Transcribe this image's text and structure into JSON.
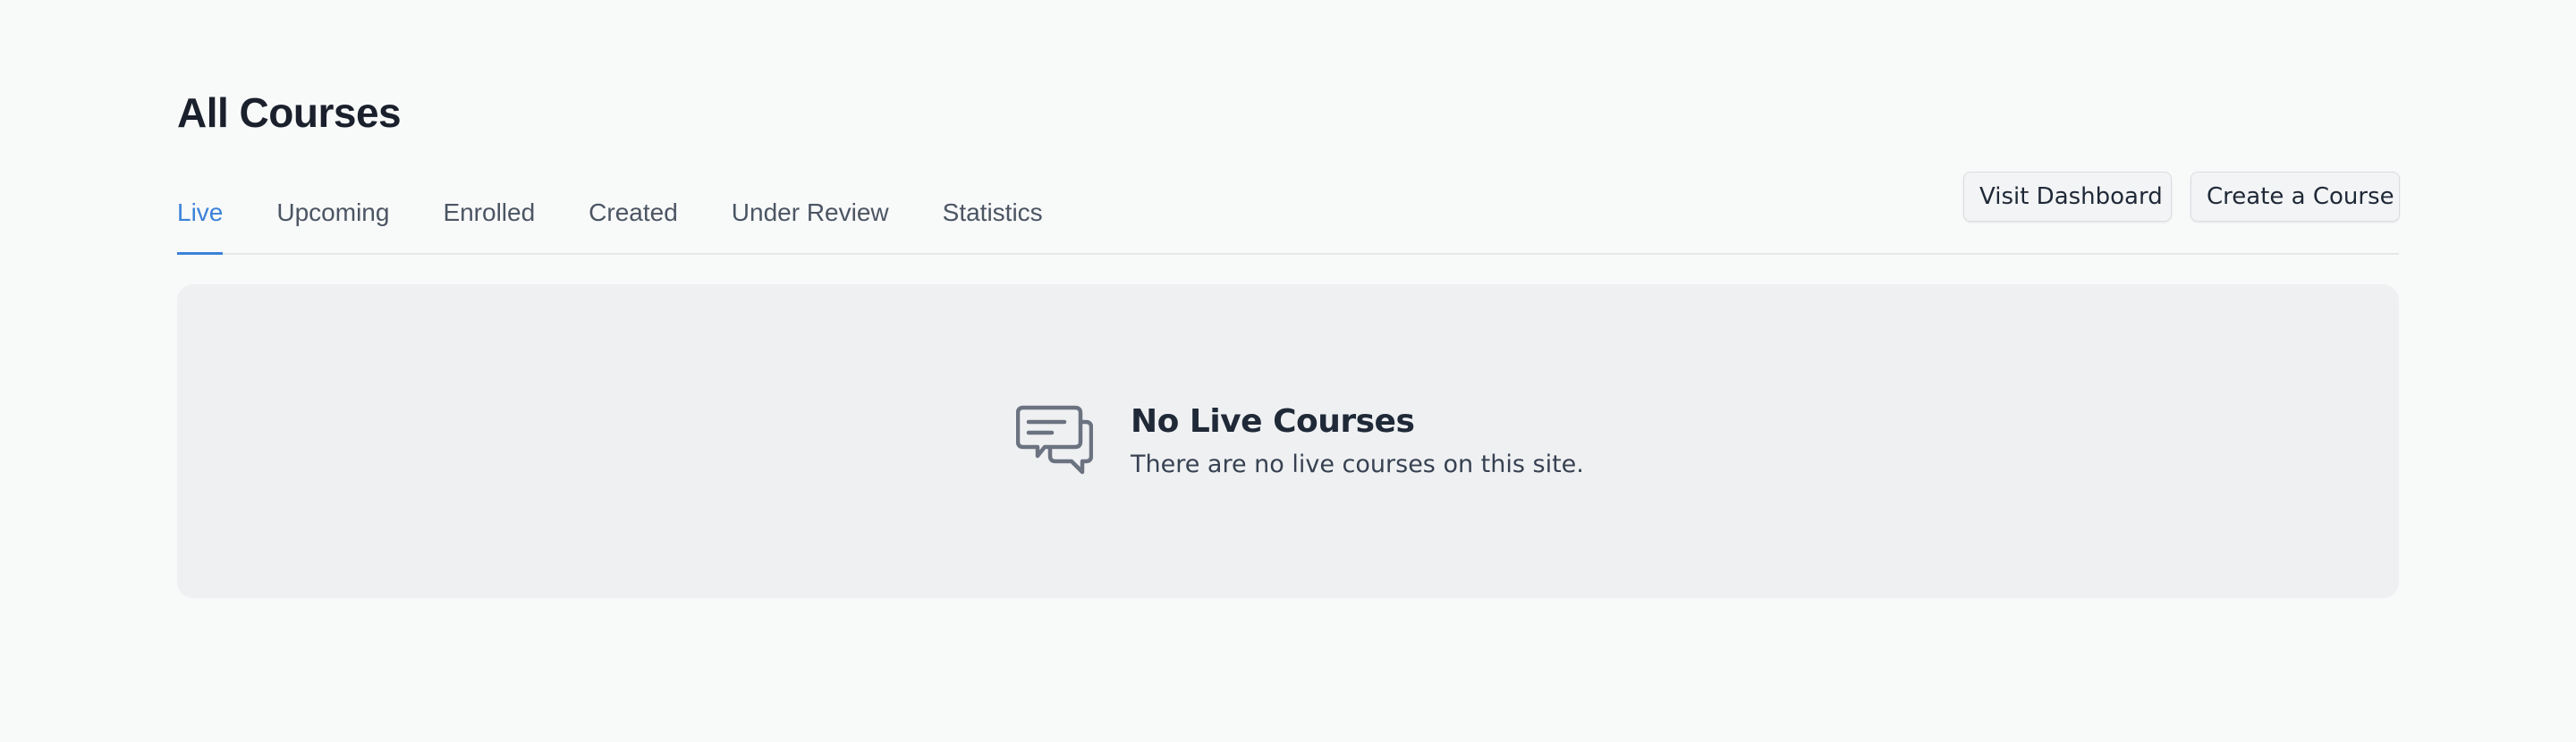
{
  "page": {
    "title": "All Courses"
  },
  "tabs": [
    {
      "label": "Live",
      "active": true
    },
    {
      "label": "Upcoming",
      "active": false
    },
    {
      "label": "Enrolled",
      "active": false
    },
    {
      "label": "Created",
      "active": false
    },
    {
      "label": "Under Review",
      "active": false
    },
    {
      "label": "Statistics",
      "active": false
    }
  ],
  "actions": {
    "visit_dashboard_label": "Visit Dashboard",
    "create_course_label": "Create a Course"
  },
  "empty_state": {
    "icon": "chat-bubbles-icon",
    "title": "No Live Courses",
    "message": "There are no live courses on this site."
  },
  "colors": {
    "accent": "#3b82d8",
    "background": "#f8f9f9",
    "panel": "#eff0f2"
  }
}
